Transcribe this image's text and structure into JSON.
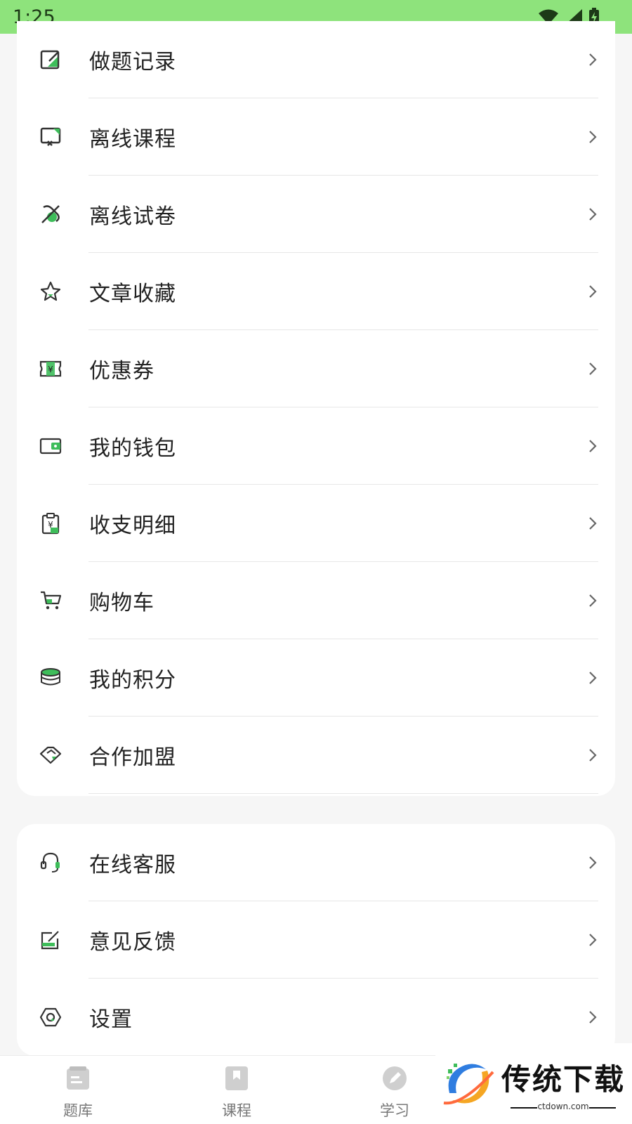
{
  "status_bar": {
    "time": "1:25",
    "icons": [
      "wifi-icon",
      "signal-icon",
      "battery-charging-icon"
    ]
  },
  "accent_color": "#3ebd5a",
  "menu_top": [
    {
      "label": "做题记录",
      "icon": "edit-record-icon"
    },
    {
      "label": "离线课程",
      "icon": "offline-course-icon"
    },
    {
      "label": "离线试卷",
      "icon": "offline-paper-icon"
    },
    {
      "label": "文章收藏",
      "icon": "star-icon"
    },
    {
      "label": "优惠券",
      "icon": "coupon-icon"
    },
    {
      "label": "我的钱包",
      "icon": "wallet-icon"
    },
    {
      "label": "收支明细",
      "icon": "bill-detail-icon"
    },
    {
      "label": "购物车",
      "icon": "cart-icon"
    },
    {
      "label": "我的积分",
      "icon": "points-icon"
    },
    {
      "label": "合作加盟",
      "icon": "handshake-icon"
    }
  ],
  "menu_bottom": [
    {
      "label": "在线客服",
      "icon": "headset-icon"
    },
    {
      "label": "意见反馈",
      "icon": "feedback-icon"
    },
    {
      "label": "设置",
      "icon": "settings-icon"
    }
  ],
  "bottom_nav": [
    {
      "label": "题库",
      "icon": "question-bank-icon"
    },
    {
      "label": "课程",
      "icon": "course-bookmark-icon"
    },
    {
      "label": "学习",
      "icon": "study-pen-icon"
    }
  ],
  "watermark": {
    "title": "传统下载",
    "subtitle": "ctdown.com"
  }
}
